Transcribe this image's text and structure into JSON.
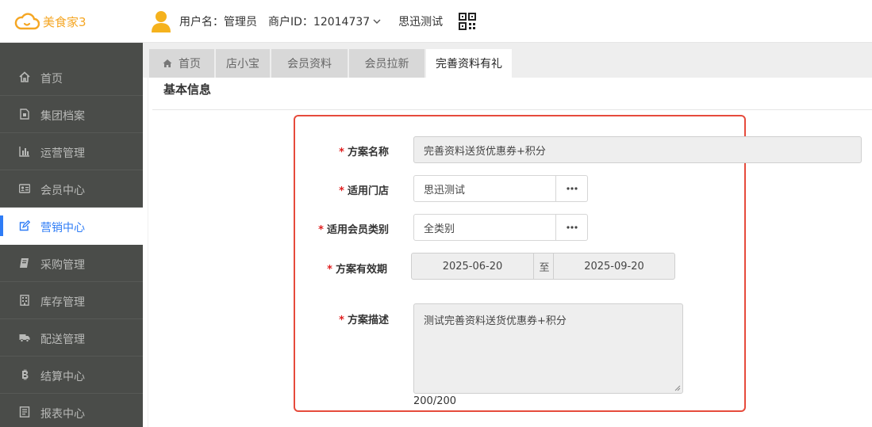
{
  "header": {
    "logo_text": "美食家3",
    "username": "用户名：管理员",
    "merchant": "商户ID：12014737",
    "store": "思迅测试"
  },
  "sidebar": {
    "items": [
      {
        "label": "首页",
        "icon": "home-icon"
      },
      {
        "label": "集团档案",
        "icon": "file-icon"
      },
      {
        "label": "运营管理",
        "icon": "bar-chart-icon"
      },
      {
        "label": "会员中心",
        "icon": "id-card-icon"
      },
      {
        "label": "营销中心",
        "icon": "edit-icon",
        "active": true
      },
      {
        "label": "采购管理",
        "icon": "book-icon"
      },
      {
        "label": "库存管理",
        "icon": "building-icon"
      },
      {
        "label": "配送管理",
        "icon": "truck-icon"
      },
      {
        "label": "结算中心",
        "icon": "bitcoin-icon"
      },
      {
        "label": "报表中心",
        "icon": "report-icon"
      }
    ]
  },
  "tabs": [
    {
      "label": "首页",
      "icon": "home-icon"
    },
    {
      "label": "店小宝"
    },
    {
      "label": "会员资料"
    },
    {
      "label": "会员拉新"
    },
    {
      "label": "完善资料有礼",
      "active": true
    }
  ],
  "section": {
    "title": "基本信息"
  },
  "form": {
    "required_mark": "*",
    "plan_name": {
      "label": "方案名称",
      "value": "完善资料送货优惠券+积分"
    },
    "store": {
      "label": "适用门店",
      "value": "思迅测试"
    },
    "member_type": {
      "label": "适用会员类别",
      "value": "全类别"
    },
    "validity": {
      "label": "方案有效期",
      "start": "2025-06-20",
      "separator": "至",
      "end": "2025-09-20"
    },
    "description": {
      "label": "方案描述",
      "value": "测试完善资料送货优惠券+积分",
      "counter": "200/200"
    }
  },
  "colors": {
    "accent": "#2e7cf6",
    "logo": "#f5a623",
    "sidebar_bg": "#4a4c49",
    "highlight": "#e64b3c",
    "required": "#e02020"
  }
}
